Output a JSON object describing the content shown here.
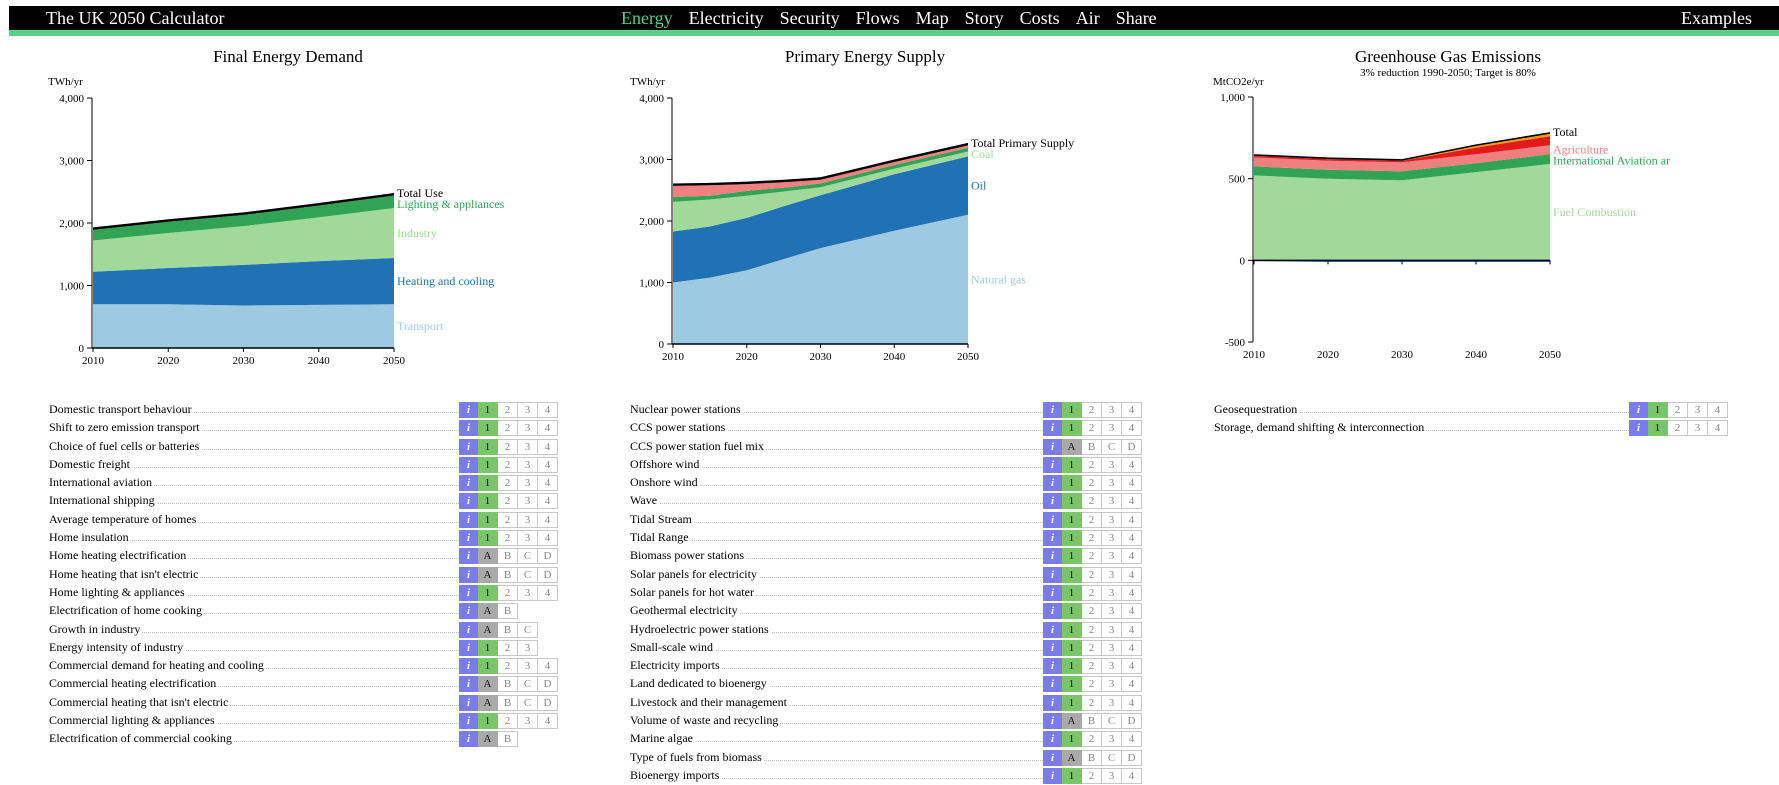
{
  "header": {
    "title": "The UK 2050 Calculator",
    "nav": [
      "Energy",
      "Electricity",
      "Security",
      "Flows",
      "Map",
      "Story",
      "Costs",
      "Air",
      "Share"
    ],
    "active_nav": "Energy",
    "examples_label": "Examples",
    "accent_color": "#5ecc8a"
  },
  "charts": [
    {
      "title": "Final Energy Demand",
      "subtitle": "",
      "unit": "TWh/yr",
      "y_ticks": [
        "4,000",
        "3,000",
        "2,000",
        "1,000",
        "0"
      ],
      "x_ticks": [
        "2010",
        "2020",
        "2030",
        "2040",
        "2050"
      ],
      "series_labels": [
        {
          "text": "Total Use",
          "color": "#000000"
        },
        {
          "text": "Lighting & appliances",
          "color": "#31a354"
        },
        {
          "text": "Industry",
          "color": "#a1d99b"
        },
        {
          "text": "Heating and cooling",
          "color": "#2171b5"
        },
        {
          "text": "Transport",
          "color": "#9ecae1"
        }
      ]
    },
    {
      "title": "Primary Energy Supply",
      "subtitle": "",
      "unit": "TWh/yr",
      "y_ticks": [
        "4,000",
        "3,000",
        "2,000",
        "1,000",
        "0"
      ],
      "x_ticks": [
        "2010",
        "2020",
        "2030",
        "2040",
        "2050"
      ],
      "series_labels": [
        {
          "text": "Total Primary Supply",
          "color": "#000000"
        },
        {
          "text": "Coal",
          "color": "#a1d99b"
        },
        {
          "text": "Oil",
          "color": "#2171b5"
        },
        {
          "text": "Natural gas",
          "color": "#9ecae1"
        }
      ]
    },
    {
      "title": "Greenhouse Gas Emissions",
      "subtitle": "3% reduction 1990-2050; Target is 80%",
      "unit": "MtCO2e/yr",
      "y_ticks": [
        "1,000",
        "500",
        "0",
        "-500"
      ],
      "x_ticks": [
        "2010",
        "2020",
        "2030",
        "2040",
        "2050"
      ],
      "series_labels": [
        {
          "text": "Total",
          "color": "#000000"
        },
        {
          "text": "Agriculture",
          "color": "#f08080"
        },
        {
          "text": "International Aviation ar",
          "color": "#31a354"
        },
        {
          "text": "Fuel Combustion",
          "color": "#a1d99b"
        }
      ]
    }
  ],
  "chart_data": [
    {
      "type": "area",
      "title": "Final Energy Demand",
      "ylabel": "TWh/yr",
      "x": [
        2010,
        2020,
        2030,
        2040,
        2050
      ],
      "ylim": [
        0,
        4000
      ],
      "stacked": true,
      "series": [
        {
          "name": "Transport",
          "values": [
            700,
            700,
            680,
            690,
            700
          ]
        },
        {
          "name": "Heating and cooling",
          "values": [
            520,
            580,
            650,
            700,
            740
          ]
        },
        {
          "name": "Industry",
          "values": [
            500,
            560,
            620,
            700,
            800
          ]
        },
        {
          "name": "Lighting & appliances",
          "values": [
            170,
            180,
            180,
            190,
            200
          ]
        },
        {
          "name": "Total Use",
          "values": [
            40,
            40,
            40,
            40,
            40
          ]
        }
      ]
    },
    {
      "type": "area",
      "title": "Primary Energy Supply",
      "ylabel": "TWh/yr",
      "x": [
        2010,
        2015,
        2020,
        2025,
        2030,
        2040,
        2050
      ],
      "ylim": [
        0,
        4000
      ],
      "stacked": true,
      "series": [
        {
          "name": "Natural gas",
          "values": [
            1000,
            1080,
            1200,
            1380,
            1560,
            1840,
            2100
          ]
        },
        {
          "name": "Oil",
          "values": [
            830,
            830,
            850,
            860,
            860,
            920,
            950
          ]
        },
        {
          "name": "Coal",
          "values": [
            480,
            440,
            360,
            240,
            130,
            90,
            80
          ]
        },
        {
          "name": "",
          "values": [
            80,
            60,
            80,
            60,
            60,
            60,
            60
          ]
        },
        {
          "name": "",
          "values": [
            180,
            170,
            110,
            90,
            60,
            50,
            40
          ]
        },
        {
          "name": "Total Primary Supply",
          "values": [
            40,
            40,
            40,
            40,
            40,
            40,
            40
          ]
        }
      ]
    },
    {
      "type": "area",
      "title": "Greenhouse Gas Emissions",
      "subtitle": "3% reduction 1990-2050; Target is 80%",
      "ylabel": "MtCO2e/yr",
      "x": [
        2010,
        2020,
        2030,
        2040,
        2050
      ],
      "ylim": [
        -500,
        1000
      ],
      "stacked": true,
      "series": [
        {
          "name": "",
          "values": [
            -5,
            -10,
            -10,
            -10,
            -10
          ]
        },
        {
          "name": "Fuel Combustion",
          "values": [
            520,
            500,
            490,
            540,
            590
          ]
        },
        {
          "name": "International Aviation ar",
          "values": [
            55,
            55,
            55,
            55,
            60
          ]
        },
        {
          "name": "Agriculture",
          "values": [
            55,
            55,
            55,
            55,
            55
          ]
        },
        {
          "name": "",
          "values": [
            10,
            10,
            10,
            40,
            55
          ]
        },
        {
          "name": "",
          "values": [
            0,
            0,
            0,
            10,
            15
          ]
        },
        {
          "name": "Total",
          "values": [
            10,
            10,
            10,
            10,
            10
          ]
        }
      ]
    }
  ],
  "lever_columns": [
    {
      "levers": [
        {
          "name": "Domestic transport behaviour",
          "levels": [
            "1",
            "2",
            "3",
            "4"
          ],
          "selected": "1"
        },
        {
          "name": "Shift to zero emission transport",
          "levels": [
            "1",
            "2",
            "3",
            "4"
          ],
          "selected": "1"
        },
        {
          "name": "Choice of fuel cells or batteries",
          "levels": [
            "1",
            "2",
            "3",
            "4"
          ],
          "selected": "1"
        },
        {
          "name": "Domestic freight",
          "levels": [
            "1",
            "2",
            "3",
            "4"
          ],
          "selected": "1"
        },
        {
          "name": "International aviation",
          "levels": [
            "1",
            "2",
            "3",
            "4"
          ],
          "selected": "1"
        },
        {
          "name": "International shipping",
          "levels": [
            "1",
            "2",
            "3",
            "4"
          ],
          "selected": "1"
        },
        {
          "name": "Average temperature of homes",
          "levels": [
            "1",
            "2",
            "3",
            "4"
          ],
          "selected": "1"
        },
        {
          "name": "Home insulation",
          "levels": [
            "1",
            "2",
            "3",
            "4"
          ],
          "selected": "1"
        },
        {
          "name": "Home heating electrification",
          "levels": [
            "A",
            "B",
            "C",
            "D"
          ],
          "selected": "A"
        },
        {
          "name": "Home heating that isn't electric",
          "levels": [
            "A",
            "B",
            "C",
            "D"
          ],
          "selected": "A"
        },
        {
          "name": "Home lighting & appliances",
          "levels": [
            "1",
            "2",
            "3",
            "4"
          ],
          "selected": "1"
        },
        {
          "name": "Electrification of home cooking",
          "levels": [
            "A",
            "B"
          ],
          "selected": "A"
        },
        {
          "name": "Growth in industry",
          "levels": [
            "A",
            "B",
            "C"
          ],
          "selected": "A"
        },
        {
          "name": "Energy intensity of industry",
          "levels": [
            "1",
            "2",
            "3"
          ],
          "selected": "1"
        },
        {
          "name": "Commercial demand for heating and cooling",
          "levels": [
            "1",
            "2",
            "3",
            "4"
          ],
          "selected": "1"
        },
        {
          "name": "Commercial heating electrification",
          "levels": [
            "A",
            "B",
            "C",
            "D"
          ],
          "selected": "A"
        },
        {
          "name": "Commercial heating that isn't electric",
          "levels": [
            "A",
            "B",
            "C",
            "D"
          ],
          "selected": "A"
        },
        {
          "name": "Commercial lighting & appliances",
          "levels": [
            "1",
            "2",
            "3",
            "4"
          ],
          "selected": "1"
        },
        {
          "name": "Electrification of commercial cooking",
          "levels": [
            "A",
            "B"
          ],
          "selected": "A"
        }
      ]
    },
    {
      "levers": [
        {
          "name": "Nuclear power stations",
          "levels": [
            "1",
            "2",
            "3",
            "4"
          ],
          "selected": "1"
        },
        {
          "name": "CCS power stations",
          "levels": [
            "1",
            "2",
            "3",
            "4"
          ],
          "selected": "1"
        },
        {
          "name": "CCS power station fuel mix",
          "levels": [
            "A",
            "B",
            "C",
            "D"
          ],
          "selected": "A"
        },
        {
          "name": "Offshore wind",
          "levels": [
            "1",
            "2",
            "3",
            "4"
          ],
          "selected": "1"
        },
        {
          "name": "Onshore wind",
          "levels": [
            "1",
            "2",
            "3",
            "4"
          ],
          "selected": "1"
        },
        {
          "name": "Wave",
          "levels": [
            "1",
            "2",
            "3",
            "4"
          ],
          "selected": "1"
        },
        {
          "name": "Tidal Stream",
          "levels": [
            "1",
            "2",
            "3",
            "4"
          ],
          "selected": "1"
        },
        {
          "name": "Tidal Range",
          "levels": [
            "1",
            "2",
            "3",
            "4"
          ],
          "selected": "1"
        },
        {
          "name": "Biomass power stations",
          "levels": [
            "1",
            "2",
            "3",
            "4"
          ],
          "selected": "1"
        },
        {
          "name": "Solar panels for electricity",
          "levels": [
            "1",
            "2",
            "3",
            "4"
          ],
          "selected": "1"
        },
        {
          "name": "Solar panels for hot water",
          "levels": [
            "1",
            "2",
            "3",
            "4"
          ],
          "selected": "1"
        },
        {
          "name": "Geothermal electricity",
          "levels": [
            "1",
            "2",
            "3",
            "4"
          ],
          "selected": "1"
        },
        {
          "name": "Hydroelectric power stations",
          "levels": [
            "1",
            "2",
            "3",
            "4"
          ],
          "selected": "1"
        },
        {
          "name": "Small-scale wind",
          "levels": [
            "1",
            "2",
            "3",
            "4"
          ],
          "selected": "1"
        },
        {
          "name": "Electricity imports",
          "levels": [
            "1",
            "2",
            "3",
            "4"
          ],
          "selected": "1"
        },
        {
          "name": "Land dedicated to bioenergy",
          "levels": [
            "1",
            "2",
            "3",
            "4"
          ],
          "selected": "1"
        },
        {
          "name": "Livestock and their management",
          "levels": [
            "1",
            "2",
            "3",
            "4"
          ],
          "selected": "1"
        },
        {
          "name": "Volume of waste and recycling",
          "levels": [
            "A",
            "B",
            "C",
            "D"
          ],
          "selected": "A"
        },
        {
          "name": "Marine algae",
          "levels": [
            "1",
            "2",
            "3",
            "4"
          ],
          "selected": "1"
        },
        {
          "name": "Type of fuels from biomass",
          "levels": [
            "A",
            "B",
            "C",
            "D"
          ],
          "selected": "A"
        },
        {
          "name": "Bioenergy imports",
          "levels": [
            "1",
            "2",
            "3",
            "4"
          ],
          "selected": "1"
        }
      ]
    },
    {
      "levers": [
        {
          "name": "Geosequestration",
          "levels": [
            "1",
            "2",
            "3",
            "4"
          ],
          "selected": "1"
        },
        {
          "name": "Storage, demand shifting & interconnection",
          "levels": [
            "1",
            "2",
            "3",
            "4"
          ],
          "selected": "1"
        }
      ]
    }
  ],
  "info_label": "i",
  "colors": {
    "info_button": "#7b7bf0",
    "selected_number": "#7ac46a",
    "selected_letter": "#a9a9a9",
    "transport": "#9ecae1",
    "heating": "#2171b5",
    "industry": "#a1d99b",
    "lighting": "#31a354",
    "agriculture": "#f08080",
    "total": "#000000"
  }
}
